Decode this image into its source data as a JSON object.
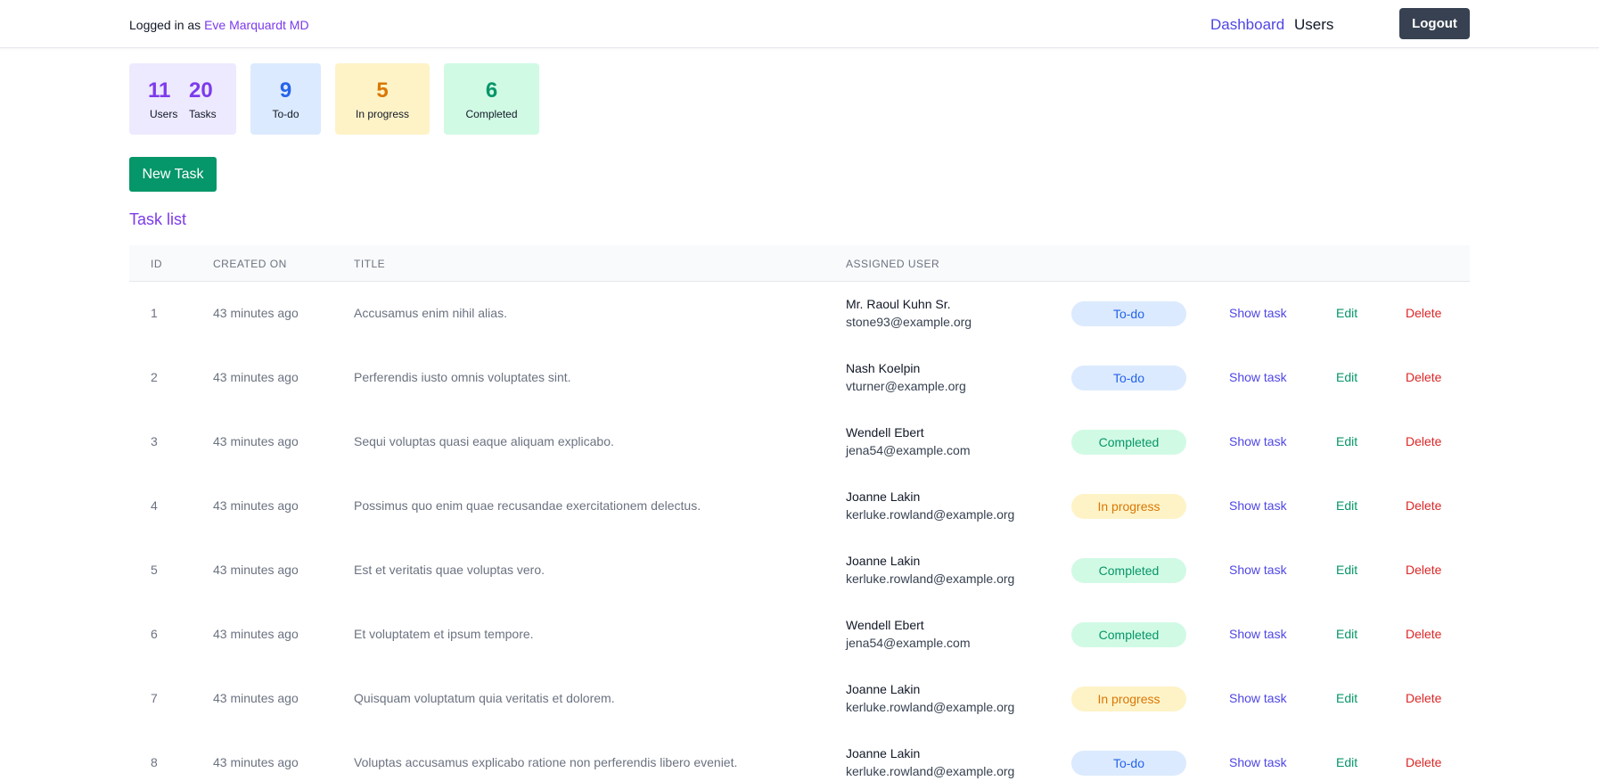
{
  "header": {
    "logged_in_prefix": "Logged in as ",
    "user_name": "Eve Marquardt MD",
    "nav_dashboard": "Dashboard",
    "nav_users": "Users",
    "logout_label": "Logout"
  },
  "stats": {
    "users": {
      "value": "11",
      "label": "Users"
    },
    "tasks": {
      "value": "20",
      "label": "Tasks"
    },
    "todo": {
      "value": "9",
      "label": "To-do"
    },
    "in_progress": {
      "value": "5",
      "label": "In progress"
    },
    "completed": {
      "value": "6",
      "label": "Completed"
    }
  },
  "new_task_label": "New Task",
  "task_list_title": "Task list",
  "table": {
    "headers": [
      "ID",
      "CREATED ON",
      "TITLE",
      "ASSIGNED USER"
    ],
    "rows": [
      {
        "id": "1",
        "created": "43 minutes ago",
        "title": "Accusamus enim nihil alias.",
        "user_name": "Mr. Raoul Kuhn Sr.",
        "user_email": "stone93@example.org",
        "status": "To-do",
        "show": "Show task",
        "edit": "Edit",
        "delete": "Delete"
      },
      {
        "id": "2",
        "created": "43 minutes ago",
        "title": "Perferendis iusto omnis voluptates sint.",
        "user_name": "Nash Koelpin",
        "user_email": "vturner@example.org",
        "status": "To-do",
        "show": "Show task",
        "edit": "Edit",
        "delete": "Delete"
      },
      {
        "id": "3",
        "created": "43 minutes ago",
        "title": "Sequi voluptas quasi eaque aliquam explicabo.",
        "user_name": "Wendell Ebert",
        "user_email": "jena54@example.com",
        "status": "Completed",
        "show": "Show task",
        "edit": "Edit",
        "delete": "Delete"
      },
      {
        "id": "4",
        "created": "43 minutes ago",
        "title": "Possimus quo enim quae recusandae exercitationem delectus.",
        "user_name": "Joanne Lakin",
        "user_email": "kerluke.rowland@example.org",
        "status": "In progress",
        "show": "Show task",
        "edit": "Edit",
        "delete": "Delete"
      },
      {
        "id": "5",
        "created": "43 minutes ago",
        "title": "Est et veritatis quae voluptas vero.",
        "user_name": "Joanne Lakin",
        "user_email": "kerluke.rowland@example.org",
        "status": "Completed",
        "show": "Show task",
        "edit": "Edit",
        "delete": "Delete"
      },
      {
        "id": "6",
        "created": "43 minutes ago",
        "title": "Et voluptatem et ipsum tempore.",
        "user_name": "Wendell Ebert",
        "user_email": "jena54@example.com",
        "status": "Completed",
        "show": "Show task",
        "edit": "Edit",
        "delete": "Delete"
      },
      {
        "id": "7",
        "created": "43 minutes ago",
        "title": "Quisquam voluptatum quia veritatis et dolorem.",
        "user_name": "Joanne Lakin",
        "user_email": "kerluke.rowland@example.org",
        "status": "In progress",
        "show": "Show task",
        "edit": "Edit",
        "delete": "Delete"
      },
      {
        "id": "8",
        "created": "43 minutes ago",
        "title": "Voluptas accusamus explicabo ratione non perferendis libero eveniet.",
        "user_name": "Joanne Lakin",
        "user_email": "kerluke.rowland@example.org",
        "status": "To-do",
        "show": "Show task",
        "edit": "Edit",
        "delete": "Delete"
      }
    ]
  },
  "status_colors": {
    "To-do": {
      "bg": "#dbeafe",
      "fg": "#2563eb"
    },
    "In progress": {
      "bg": "#fef3c7",
      "fg": "#d97706"
    },
    "Completed": {
      "bg": "#d1fae5",
      "fg": "#059669"
    }
  },
  "colors": {
    "users_stat": "#7c3aed",
    "todo_stat": "#2563eb",
    "progress_stat": "#d97706",
    "completed_stat": "#059669"
  }
}
